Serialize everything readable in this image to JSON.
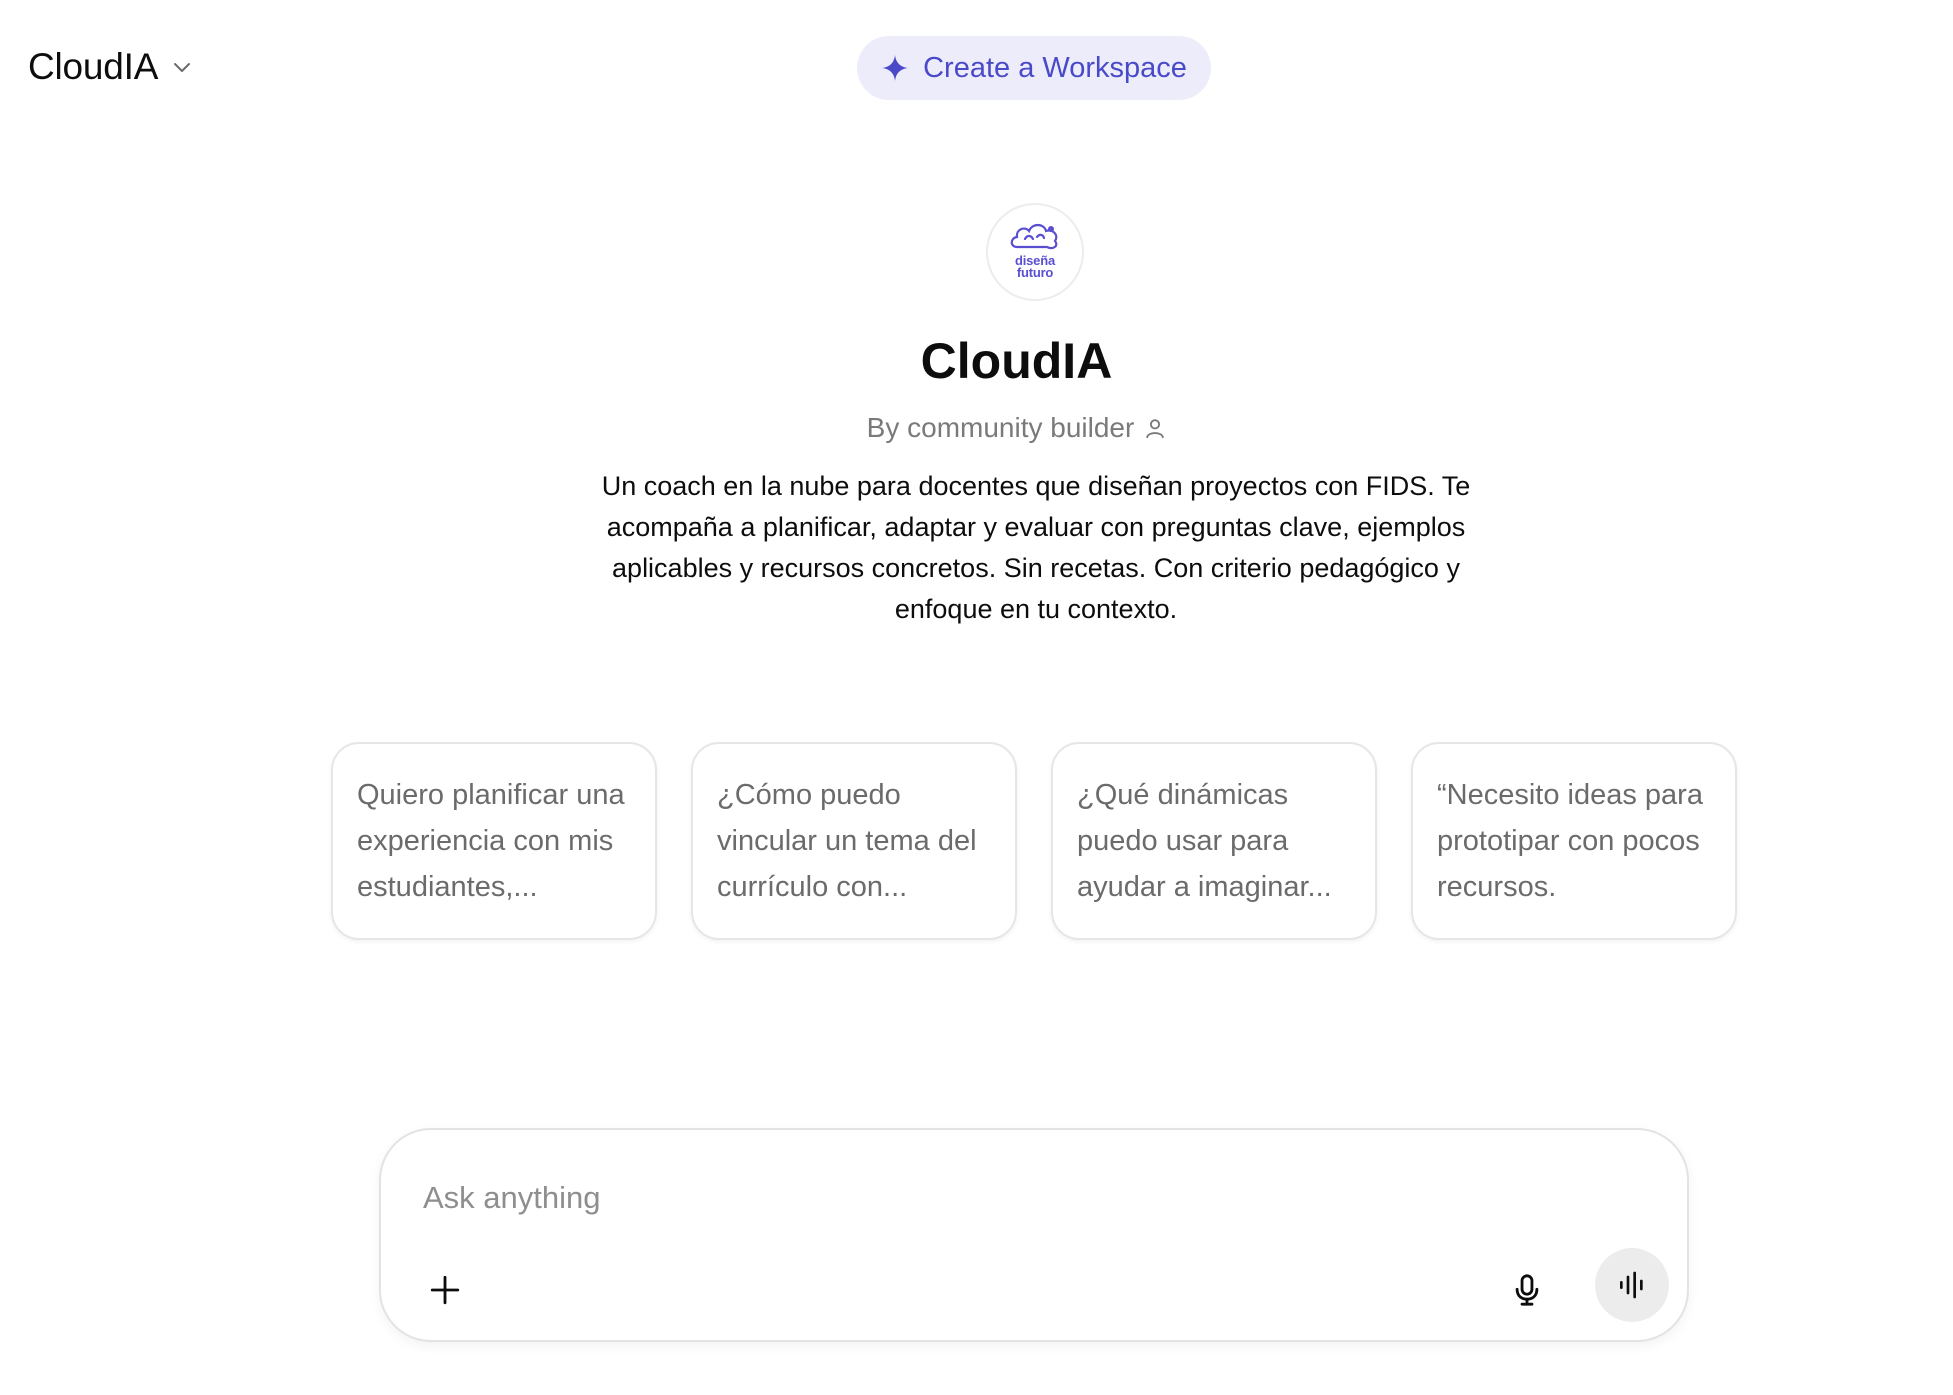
{
  "header": {
    "model_name": "CloudIA",
    "workspace_button": "Create a Workspace"
  },
  "profile": {
    "logo_text_line1": "diseña",
    "logo_text_line2": "futuro",
    "title": "CloudIA",
    "byline": "By community builder",
    "description": "Un coach en la nube para docentes que diseñan proyectos con FIDS. Te acompaña a planificar, adaptar y evaluar con preguntas clave, ejemplos aplicables y recursos concretos. Sin recetas. Con criterio pedagógico y enfoque en tu contexto."
  },
  "starters": [
    {
      "text": "Quiero planificar una experiencia con mis estudiantes,..."
    },
    {
      "text": "¿Cómo puedo vincular un tema del currículo con..."
    },
    {
      "text": "¿Qué dinámicas puedo usar para ayudar a imaginar..."
    },
    {
      "text": "“Necesito ideas para prototipar con pocos recursos."
    }
  ],
  "composer": {
    "placeholder": "Ask anything",
    "value": ""
  },
  "colors": {
    "accent": "#4a4ac9",
    "accent_bg": "#ececfb",
    "logo": "#5a4ed1"
  },
  "icons": {
    "model_chevron": "chevron-down-icon",
    "workspace": "sparkle-icon",
    "byline": "person-icon",
    "attach": "plus-icon",
    "dictate": "microphone-icon",
    "voice": "voice-waveform-icon"
  }
}
